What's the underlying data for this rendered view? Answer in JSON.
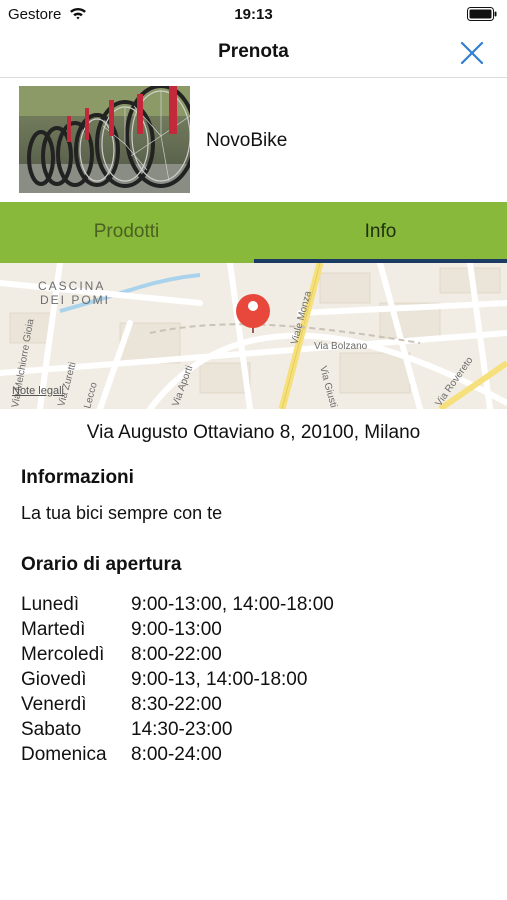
{
  "status_bar": {
    "carrier": "Gestore",
    "time": "19:13"
  },
  "nav": {
    "title": "Prenota",
    "close_icon": "close-icon"
  },
  "shop": {
    "name": "NovoBike",
    "thumbnail_icon": "bike-photo"
  },
  "tabs": [
    {
      "label": "Prodotti",
      "selected": false
    },
    {
      "label": "Info",
      "selected": true
    }
  ],
  "map": {
    "labels": {
      "district_line1": "CASCINA",
      "district_line2": "DEI POMI",
      "street_gioia": "Via Melchiorre Gioia",
      "street_monza": "Viale Monza",
      "street_bolzano": "Via Bolzano",
      "street_giusti": "Via Giusti",
      "street_aporti": "Via Aporti",
      "street_zuretti": "Via Zuretti",
      "street_rovereto": "Via Rovereto",
      "street_lecco": "Lecco"
    },
    "legal_link": "Note legali",
    "pin_color": "#e8483c"
  },
  "address": "Via Augusto Ottaviano 8, 20100, Milano",
  "info": {
    "title": "Informazioni",
    "text": "La tua bici sempre con te"
  },
  "hours": {
    "title": "Orario di apertura",
    "rows": [
      {
        "day": "Lunedì",
        "time": "9:00-13:00, 14:00-18:00"
      },
      {
        "day": "Martedì",
        "time": "9:00-13:00"
      },
      {
        "day": "Mercoledì",
        "time": "8:00-22:00"
      },
      {
        "day": "Giovedì",
        "time": "9:00-13, 14:00-18:00"
      },
      {
        "day": "Venerdì",
        "time": "8:30-22:00"
      },
      {
        "day": "Sabato",
        "time": "14:30-23:00"
      },
      {
        "day": "Domenica",
        "time": "8:00-24:00"
      }
    ]
  },
  "colors": {
    "accent": "#2f7fd1",
    "tab_bar": "#88b93a",
    "tab_indicator": "#1c3b63"
  }
}
